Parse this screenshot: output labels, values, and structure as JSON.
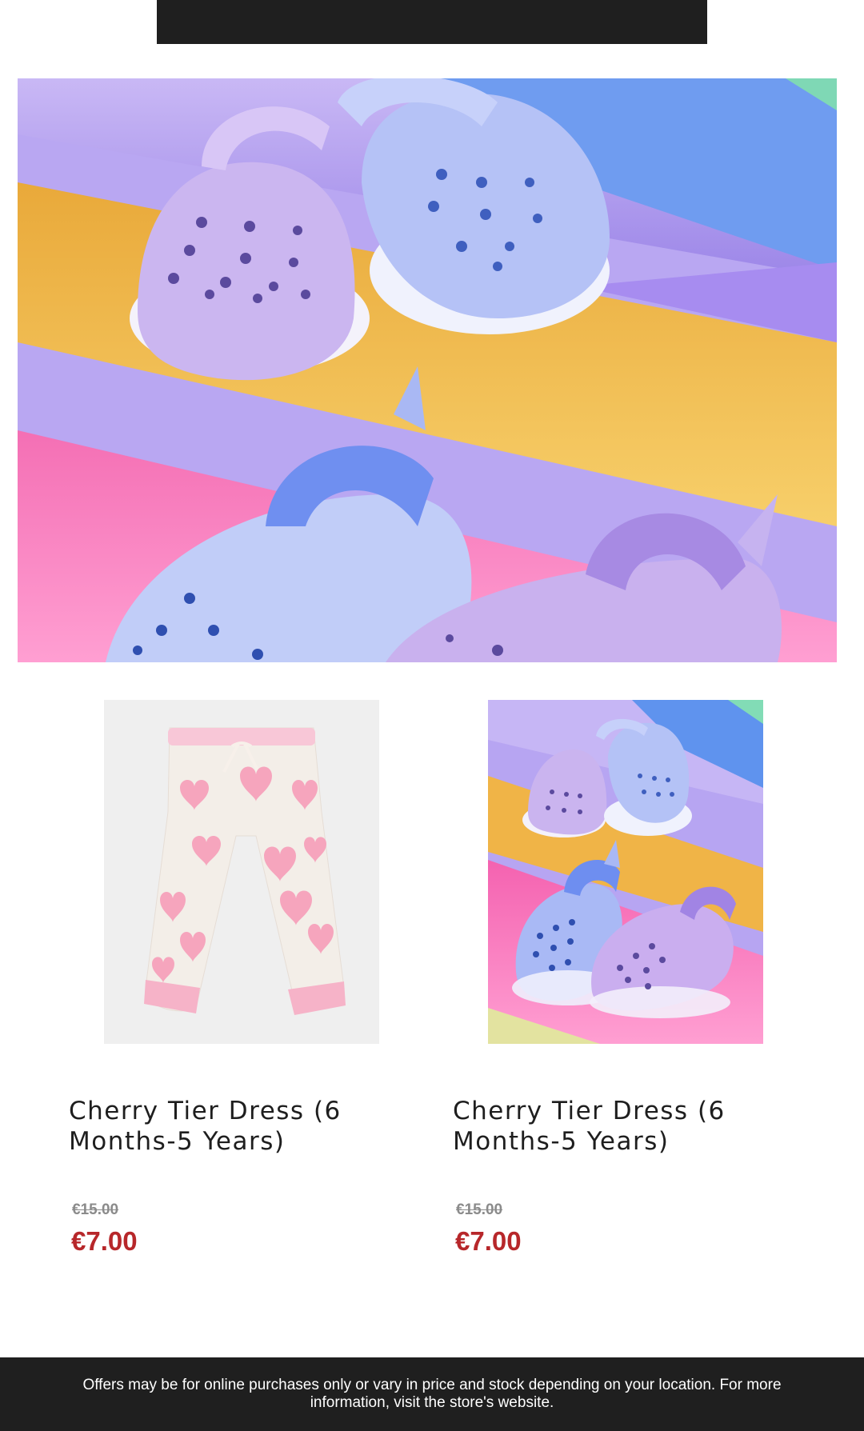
{
  "header": {
    "bar_color": "#1f1f1f"
  },
  "hero": {
    "image": "clogs-on-rainbow-tubes-image"
  },
  "products": [
    {
      "image": "heart-print-joggers-image",
      "title": "Cherry Tier Dress (6 Months-5 Years)",
      "original_price": "€15.00",
      "sale_price": "€7.00"
    },
    {
      "image": "clogs-on-rainbow-tubes-image",
      "title": "Cherry Tier Dress (6 Months-5 Years)",
      "original_price": "€15.00",
      "sale_price": "€7.00"
    }
  ],
  "colors": {
    "sale_price": "#b7272a",
    "original_price": "#8b8b8b",
    "footer_bg": "#1f1f1f"
  },
  "footer": {
    "disclaimer": "Offers may be for online purchases only or vary in price and stock depending on your location. For more information, visit the store's website."
  }
}
